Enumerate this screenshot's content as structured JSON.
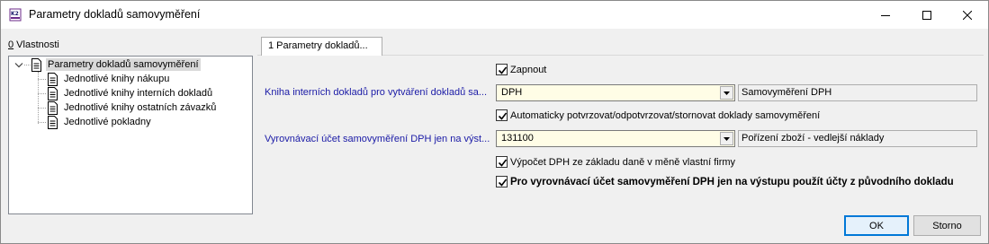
{
  "window": {
    "title": "Parametry dokladů samovyměření",
    "app_icon": "k2-app-icon",
    "controls": [
      "minimize-icon",
      "maximize-icon",
      "close-icon"
    ]
  },
  "properties": {
    "label_accel": "0",
    "label_rest": " Vlastnosti"
  },
  "tree": {
    "root": "Parametry dokladů samovyměření",
    "children": [
      "Jednotlivé knihy nákupu",
      "Jednotlivé knihy interních dokladů",
      "Jednotlivé knihy ostatních závazků",
      "Jednotlivé pokladny"
    ]
  },
  "tabs": [
    {
      "label": "1 Parametry dokladů..."
    }
  ],
  "form": {
    "enable_label": "Zapnout",
    "enable_checked": true,
    "internal_book_label": "Kniha interních dokladů pro vytváření dokladů sa...",
    "internal_book_value": "DPH",
    "internal_book_desc": "Samovyměření DPH",
    "auto_confirm_label": "Automaticky potvrzovat/odpotvrzovat/stornovat doklady samovyměření",
    "auto_confirm_checked": true,
    "clearing_account_label": "Vyrovnávací účet samovyměření DPH jen na výst...",
    "clearing_account_value": "131100",
    "clearing_account_desc": "Pořízení zboží - vedlejší náklady",
    "vat_calc_label": "Výpočet DPH ze základu daně v měně vlastní firmy",
    "vat_calc_checked": true,
    "use_original_label": "Pro vyrovnávací účet samovyměření DPH jen na výstupu použít účty z původního dokladu",
    "use_original_checked": true
  },
  "buttons": {
    "ok": "OK",
    "cancel": "Storno"
  },
  "colors": {
    "link_label": "#1a1aa6",
    "combo_bg": "#fffde6",
    "default_button_border": "#0078d7"
  }
}
